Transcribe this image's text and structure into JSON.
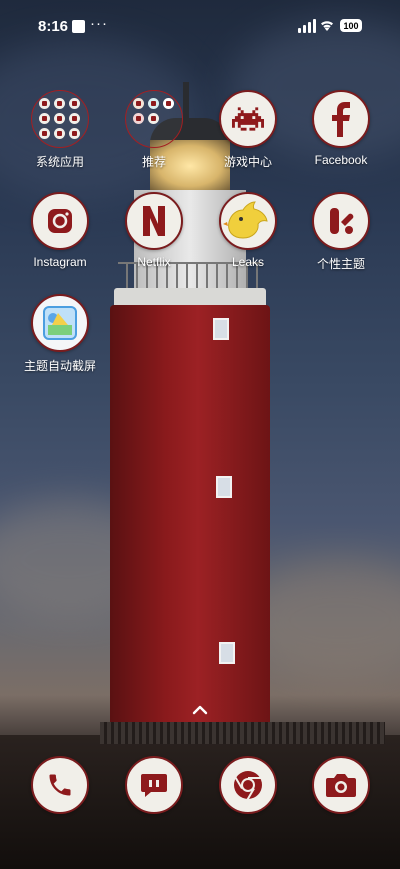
{
  "status_bar": {
    "time": "8:16",
    "overflow": "···",
    "battery": "100",
    "icons": [
      "notification-square-icon",
      "signal-icon",
      "wifi-icon",
      "battery-icon"
    ]
  },
  "home_grid": {
    "apps": [
      {
        "label": "系统应用",
        "kind": "folder"
      },
      {
        "label": "推荐",
        "kind": "folder"
      },
      {
        "label": "游戏中心",
        "icon": "space-invader-icon"
      },
      {
        "label": "Facebook",
        "icon": "facebook-icon"
      },
      {
        "label": "Instagram",
        "icon": "instagram-icon"
      },
      {
        "label": "Netflix",
        "icon": "netflix-icon"
      },
      {
        "label": "Leaks",
        "icon": "yellow-bird-icon"
      },
      {
        "label": "个性主题",
        "icon": "theme-icon"
      },
      {
        "label": "主题自动截屏",
        "icon": "screenshot-icon"
      }
    ]
  },
  "dock": {
    "apps": [
      {
        "icon": "phone-icon"
      },
      {
        "icon": "messages-icon"
      },
      {
        "icon": "chrome-icon"
      },
      {
        "icon": "camera-icon"
      }
    ]
  },
  "theme": {
    "accent": "#8e1a1c",
    "tile_bg": "#f1efe9"
  }
}
